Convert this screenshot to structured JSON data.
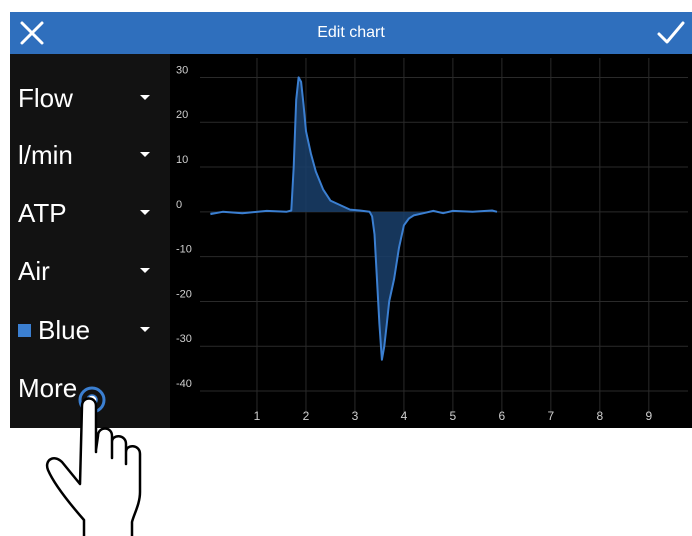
{
  "header": {
    "title": "Edit chart",
    "close_icon": "close-icon",
    "confirm_icon": "check-icon",
    "color": "#2f6fbd"
  },
  "sidebar": {
    "items": [
      {
        "label": "Flow",
        "has_dropdown": true
      },
      {
        "label": "l/min",
        "has_dropdown": true
      },
      {
        "label": "ATP",
        "has_dropdown": true
      },
      {
        "label": "Air",
        "has_dropdown": true
      },
      {
        "label": "Blue",
        "has_dropdown": true,
        "swatch": "#3b7fd1"
      },
      {
        "label": "More",
        "has_dropdown": false
      }
    ]
  },
  "chart_data": {
    "type": "area",
    "title": "",
    "xlabel": "",
    "ylabel": "",
    "xlim": [
      0,
      9.8
    ],
    "ylim": [
      -42,
      33
    ],
    "x_ticks": [
      "1",
      "2",
      "3",
      "4",
      "5",
      "6",
      "7",
      "8",
      "9"
    ],
    "y_ticks": [
      "30",
      "20",
      "10",
      "0",
      "-10",
      "-20",
      "-30",
      "-40"
    ],
    "grid": true,
    "series": [
      {
        "color": "#3b7fd1",
        "fill": "#1a3f6b",
        "x": [
          0.05,
          0.3,
          0.7,
          1.2,
          1.6,
          1.7,
          1.75,
          1.8,
          1.85,
          1.9,
          1.95,
          2.0,
          2.1,
          2.2,
          2.35,
          2.5,
          2.7,
          2.9,
          3.1,
          3.3,
          3.35,
          3.4,
          3.5,
          3.55,
          3.6,
          3.65,
          3.7,
          3.8,
          3.9,
          4.0,
          4.1,
          4.2,
          4.4,
          4.6,
          4.8,
          5.0,
          5.4,
          5.8,
          5.9
        ],
        "y": [
          -0.5,
          0,
          -0.3,
          0.2,
          0,
          0.3,
          10,
          25,
          30,
          29,
          24,
          18,
          13,
          9,
          5,
          2.5,
          1.5,
          0.5,
          0.3,
          0,
          -1,
          -5,
          -25,
          -33,
          -30,
          -25,
          -20,
          -15,
          -8,
          -3,
          -1.5,
          -0.8,
          -0.3,
          0.2,
          -0.3,
          0.2,
          0,
          0.3,
          0
        ]
      }
    ]
  },
  "hand_icon": "tap-gesture-icon"
}
